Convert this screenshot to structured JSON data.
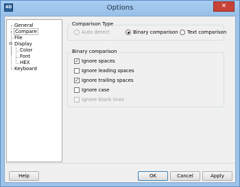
{
  "window": {
    "title": "Options",
    "app_icon": "4D",
    "close_glyph": "✕"
  },
  "tree": {
    "items": [
      {
        "label": "General"
      },
      {
        "label": "Compare"
      },
      {
        "label": "File"
      },
      {
        "label": "Display",
        "expander": "⊟"
      },
      {
        "label": "Color"
      },
      {
        "label": "Font"
      },
      {
        "label": "HEX"
      },
      {
        "label": "Keyboard"
      }
    ]
  },
  "comparison_type": {
    "title": "Comparison Type",
    "options": [
      {
        "label": "Auto detect",
        "checked": false,
        "disabled": true
      },
      {
        "label": "Binary comparison",
        "checked": true,
        "disabled": false
      },
      {
        "label": "Text comparison",
        "checked": false,
        "disabled": false
      }
    ]
  },
  "binary_comparison": {
    "title": "Binary comparison",
    "options": [
      {
        "label": "Ignore spaces",
        "checked": true,
        "disabled": false
      },
      {
        "label": "Ignore leading spaces",
        "checked": false,
        "disabled": false
      },
      {
        "label": "Ignore trailing spaces",
        "checked": true,
        "disabled": false
      },
      {
        "label": "Ignore case",
        "checked": false,
        "disabled": false
      },
      {
        "label": "Ignore blank lines",
        "checked": false,
        "disabled": true
      }
    ]
  },
  "check_glyph": "✓",
  "buttons": {
    "help": "Help",
    "ok": "OK",
    "cancel": "Cancel",
    "apply": "Apply"
  }
}
